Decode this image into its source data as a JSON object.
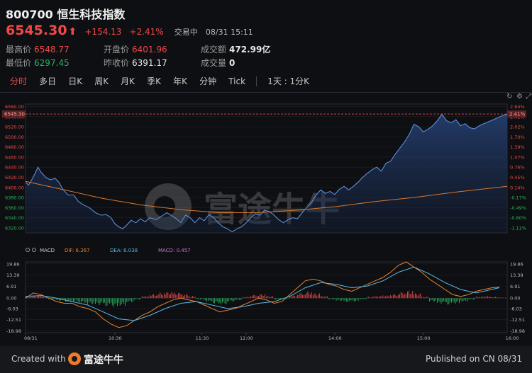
{
  "header": {
    "code": "800700",
    "name": "恒生科技指数",
    "price": "6545.30",
    "change": "+154.13",
    "change_pct": "+2.41%",
    "status": "交易中",
    "datetime": "08/31 15:11"
  },
  "stats": {
    "high_label": "最高价",
    "high": "6548.77",
    "low_label": "最低价",
    "low": "6297.45",
    "open_label": "开盘价",
    "open": "6401.96",
    "prev_close_label": "昨收价",
    "prev_close": "6391.17",
    "turnover_label": "成交额",
    "turnover": "472.99亿",
    "volume_label": "成交量",
    "volume": "0"
  },
  "tabs": [
    {
      "label": "分时",
      "active": true
    },
    {
      "label": "多日"
    },
    {
      "label": "日K"
    },
    {
      "label": "周K"
    },
    {
      "label": "月K"
    },
    {
      "label": "季K"
    },
    {
      "label": "年K"
    },
    {
      "label": "分钟"
    },
    {
      "label": "Tick"
    },
    {
      "label": "1天 : 1分K"
    }
  ],
  "watermark": "富途牛牛",
  "footer": {
    "created_with": "Created with",
    "brand": "富途牛牛",
    "published": "Published on CN 08/31"
  },
  "colors": {
    "up": "#f04848",
    "down": "#27b35f",
    "line": "#5b8fd8",
    "ma": "#d9772b",
    "dif": "#e8822a",
    "dea": "#5ab8e8",
    "macd": "#d070d0"
  },
  "chart_data": [
    {
      "type": "area",
      "name": "price",
      "y_ticks_left": [
        "6560.00",
        "6540.00",
        "6520.00",
        "6500.00",
        "6480.00",
        "6460.00",
        "6440.00",
        "6420.00",
        "6400.00",
        "6380.00",
        "6360.00",
        "6340.00",
        "6320.00"
      ],
      "y_ticks_left_color": [
        "up",
        "up",
        "up",
        "up",
        "up",
        "up",
        "up",
        "up",
        "up",
        "down",
        "down",
        "down",
        "down"
      ],
      "y_ticks_right": [
        "2.64%",
        "2.41%",
        "2.02%",
        "1.70%",
        "1.39%",
        "1.07%",
        "0.76%",
        "0.45%",
        "0.14%",
        "-0.17%",
        "-0.49%",
        "-0.80%",
        "-1.11%"
      ],
      "current_tag_left": "6545.30",
      "current_tag_right": "2.41%",
      "ylim": [
        6310,
        6565
      ],
      "x_ticks": [
        "08/31",
        "10:30",
        "11:30",
        "12:00",
        "14:00",
        "15:00",
        "16:00"
      ],
      "price_path": [
        [
          0,
          6410
        ],
        [
          0.4,
          6405
        ],
        [
          0.9,
          6418
        ],
        [
          1.3,
          6430
        ],
        [
          1.6,
          6440
        ],
        [
          2,
          6430
        ],
        [
          2.6,
          6420
        ],
        [
          3.2,
          6415
        ],
        [
          3.8,
          6418
        ],
        [
          4.3,
          6410
        ],
        [
          4.8,
          6396
        ],
        [
          5.5,
          6385
        ],
        [
          6.2,
          6385
        ],
        [
          6.8,
          6372
        ],
        [
          7.5,
          6365
        ],
        [
          8.2,
          6360
        ],
        [
          9,
          6350
        ],
        [
          9.7,
          6345
        ],
        [
          10.4,
          6346
        ],
        [
          11,
          6340
        ],
        [
          11.5,
          6328
        ],
        [
          12,
          6322
        ],
        [
          12.5,
          6318
        ],
        [
          13,
          6325
        ],
        [
          13.6,
          6335
        ],
        [
          14.2,
          6330
        ],
        [
          14.8,
          6338
        ],
        [
          15.4,
          6332
        ],
        [
          16,
          6340
        ],
        [
          16.8,
          6336
        ],
        [
          17.5,
          6343
        ],
        [
          18.2,
          6350
        ],
        [
          18.8,
          6344
        ],
        [
          19.4,
          6338
        ],
        [
          20,
          6330
        ],
        [
          20.6,
          6345
        ],
        [
          21.2,
          6340
        ],
        [
          21.8,
          6330
        ],
        [
          22.4,
          6340
        ],
        [
          23,
          6334
        ],
        [
          23.6,
          6346
        ],
        [
          24.2,
          6340
        ],
        [
          24.8,
          6330
        ],
        [
          25.4,
          6322
        ],
        [
          26,
          6318
        ],
        [
          26.6,
          6312
        ],
        [
          27.2,
          6318
        ],
        [
          27.8,
          6322
        ],
        [
          28.4,
          6330
        ],
        [
          29,
          6340
        ],
        [
          29.6,
          6348
        ],
        [
          30.2,
          6345
        ],
        [
          30.8,
          6355
        ],
        [
          31.4,
          6352
        ],
        [
          32,
          6345
        ],
        [
          32.6,
          6336
        ],
        [
          33.2,
          6330
        ],
        [
          33.8,
          6336
        ],
        [
          34.4,
          6340
        ],
        [
          35,
          6338
        ],
        [
          35.6,
          6350
        ],
        [
          36.2,
          6360
        ],
        [
          36.8,
          6370
        ],
        [
          37.4,
          6385
        ],
        [
          38,
          6395
        ],
        [
          38.6,
          6388
        ],
        [
          39.2,
          6392
        ],
        [
          39.8,
          6386
        ],
        [
          40.4,
          6396
        ],
        [
          41,
          6402
        ],
        [
          41.6,
          6395
        ],
        [
          42.2,
          6402
        ],
        [
          42.8,
          6410
        ],
        [
          43.4,
          6420
        ],
        [
          44,
          6428
        ],
        [
          44.6,
          6435
        ],
        [
          45.2,
          6440
        ],
        [
          45.8,
          6432
        ],
        [
          46.4,
          6448
        ],
        [
          47,
          6452
        ],
        [
          47.6,
          6466
        ],
        [
          48.2,
          6478
        ],
        [
          48.8,
          6490
        ],
        [
          49.4,
          6505
        ],
        [
          50,
          6525
        ],
        [
          50.6,
          6520
        ],
        [
          51.2,
          6510
        ],
        [
          51.8,
          6515
        ],
        [
          52.4,
          6522
        ],
        [
          53,
          6532
        ],
        [
          53.6,
          6545
        ],
        [
          54.2,
          6532
        ],
        [
          54.8,
          6528
        ],
        [
          55.4,
          6534
        ],
        [
          56,
          6522
        ],
        [
          56.6,
          6526
        ],
        [
          57.2,
          6518
        ],
        [
          57.8,
          6516
        ],
        [
          58.4,
          6522
        ],
        [
          59,
          6526
        ],
        [
          59.6,
          6530
        ],
        [
          60.2,
          6534
        ],
        [
          60.8,
          6538
        ],
        [
          61.4,
          6542
        ],
        [
          62,
          6545
        ]
      ],
      "ma_path": [
        [
          0,
          6412
        ],
        [
          5,
          6395
        ],
        [
          10,
          6378
        ],
        [
          15,
          6365
        ],
        [
          20,
          6356
        ],
        [
          25,
          6350
        ],
        [
          30,
          6350
        ],
        [
          35,
          6355
        ],
        [
          40,
          6362
        ],
        [
          45,
          6372
        ],
        [
          50,
          6380
        ],
        [
          55,
          6390
        ],
        [
          62,
          6402
        ]
      ]
    },
    {
      "type": "line",
      "name": "MACD",
      "legend_label": "MACD",
      "dif_label": "DIF: 6.267",
      "dea_label": "DEA: 6.038",
      "macd_label": "MACD: 0.457",
      "y_ticks": [
        "19.86",
        "13.39",
        "6.91",
        "0.00",
        "-6.03",
        "-12.51",
        "-18.98"
      ],
      "ylim": [
        -20,
        21
      ],
      "dif": [
        [
          0,
          0
        ],
        [
          1,
          3
        ],
        [
          2,
          2
        ],
        [
          3,
          0
        ],
        [
          4,
          -2
        ],
        [
          5,
          -3
        ],
        [
          6,
          -3
        ],
        [
          7,
          -5
        ],
        [
          8,
          -6
        ],
        [
          9,
          -8
        ],
        [
          10,
          -12
        ],
        [
          11,
          -15
        ],
        [
          12,
          -17
        ],
        [
          13,
          -16
        ],
        [
          14,
          -13
        ],
        [
          15,
          -10
        ],
        [
          16,
          -8
        ],
        [
          17,
          -5
        ],
        [
          18,
          -3
        ],
        [
          19,
          -1
        ],
        [
          20,
          0
        ],
        [
          21,
          -1
        ],
        [
          22,
          -2
        ],
        [
          23,
          -4
        ],
        [
          24,
          -6
        ],
        [
          25,
          -8
        ],
        [
          26,
          -7
        ],
        [
          27,
          -6
        ],
        [
          28,
          -4
        ],
        [
          29,
          -2
        ],
        [
          30,
          0
        ],
        [
          31,
          -1
        ],
        [
          32,
          -3
        ],
        [
          33,
          -2
        ],
        [
          34,
          2
        ],
        [
          35,
          6
        ],
        [
          36,
          10
        ],
        [
          37,
          11
        ],
        [
          38,
          10
        ],
        [
          39,
          8
        ],
        [
          40,
          7
        ],
        [
          41,
          5
        ],
        [
          42,
          4
        ],
        [
          43,
          6
        ],
        [
          44,
          8
        ],
        [
          45,
          10
        ],
        [
          46,
          12
        ],
        [
          47,
          15
        ],
        [
          48,
          19
        ],
        [
          49,
          21
        ],
        [
          50,
          18
        ],
        [
          51,
          15
        ],
        [
          52,
          11
        ],
        [
          53,
          8
        ],
        [
          54,
          5
        ],
        [
          55,
          2
        ],
        [
          56,
          1
        ],
        [
          57,
          2
        ],
        [
          58,
          4
        ],
        [
          59,
          5
        ],
        [
          60,
          6
        ],
        [
          61,
          6.27
        ]
      ],
      "dea": [
        [
          0,
          1
        ],
        [
          2,
          1.5
        ],
        [
          4,
          0
        ],
        [
          6,
          -2
        ],
        [
          8,
          -4
        ],
        [
          10,
          -8
        ],
        [
          12,
          -12
        ],
        [
          14,
          -13
        ],
        [
          16,
          -10
        ],
        [
          18,
          -6
        ],
        [
          20,
          -3
        ],
        [
          22,
          -2
        ],
        [
          24,
          -4
        ],
        [
          26,
          -6
        ],
        [
          28,
          -5
        ],
        [
          30,
          -3
        ],
        [
          32,
          -2
        ],
        [
          34,
          1
        ],
        [
          36,
          6
        ],
        [
          38,
          9
        ],
        [
          40,
          8
        ],
        [
          42,
          6
        ],
        [
          44,
          7
        ],
        [
          46,
          10
        ],
        [
          48,
          15
        ],
        [
          50,
          18
        ],
        [
          52,
          14
        ],
        [
          54,
          9
        ],
        [
          56,
          5
        ],
        [
          58,
          3
        ],
        [
          60,
          5
        ],
        [
          61,
          6.04
        ]
      ],
      "macd_bars": [
        0.2,
        0.4,
        0.3,
        -0.2,
        -0.4,
        -0.6,
        -0.5,
        -0.7,
        -0.9,
        -1,
        -1.2,
        -1.3,
        -1.1,
        -0.6,
        -0.2,
        0.3,
        0.6,
        0.8,
        0.9,
        0.8,
        0.6,
        0.3,
        -0.2,
        -0.5,
        -0.8,
        -0.9,
        -0.5,
        -0.3,
        0.2,
        0.5,
        0.6,
        0.3,
        -0.2,
        -0.1,
        0.4,
        0.8,
        1,
        0.7,
        0.3,
        -0.2,
        -0.4,
        -0.6,
        -0.5,
        -0.2,
        0.2,
        0.3,
        0.4,
        0.6,
        0.9,
        1.1,
        0.7,
        0.2,
        -0.5,
        -0.8,
        -1,
        -0.8,
        -0.5,
        -0.2,
        0.2,
        0.3,
        0.2,
        0.1
      ]
    }
  ]
}
